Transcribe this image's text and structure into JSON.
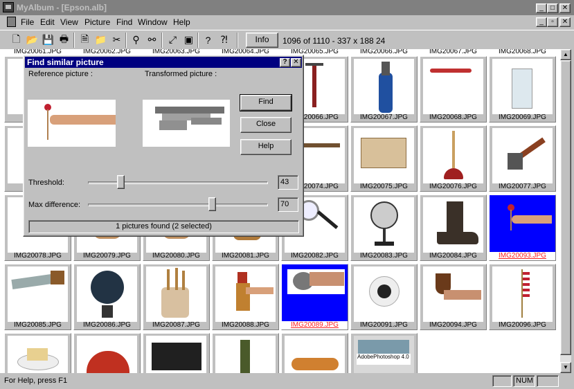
{
  "window": {
    "title": "MyAlbum - [Epson.alb]"
  },
  "menu": [
    "File",
    "Edit",
    "View",
    "Picture",
    "Find",
    "Window",
    "Help"
  ],
  "menu_underline": [
    "F",
    "E",
    "V",
    "P",
    "i",
    "W",
    "H"
  ],
  "toolbar": {
    "info_label": "Info",
    "status": "1096 of 1110 - 337 x 188  24",
    "icons": [
      "new-icon",
      "open-icon",
      "save-icon",
      "print-icon",
      "import-icon",
      "open-folder-icon",
      "cut-icon",
      "find-binoculars-icon",
      "find-similar-icon",
      "resize-icon",
      "slideshow-icon",
      "help-icon",
      "context-help-icon"
    ]
  },
  "thumbnails": [
    {
      "name": "IMG20078.JPG",
      "selected": false,
      "icon": "lollipop-hand"
    },
    {
      "name": "IMG20079.JPG",
      "selected": false,
      "icon": "item"
    },
    {
      "name": "IMG20080.JPG",
      "selected": false,
      "icon": "item"
    },
    {
      "name": "IMG20081.JPG",
      "selected": false,
      "icon": "dog"
    },
    {
      "name": "IMG20082.JPG",
      "selected": false,
      "icon": "magnifier"
    },
    {
      "name": "IMG20083.JPG",
      "selected": false,
      "icon": "fan"
    },
    {
      "name": "IMG20084.JPG",
      "selected": false,
      "icon": "boot"
    },
    {
      "name": "IMG20093.JPG",
      "selected": true,
      "icon": "lollipop-hand"
    },
    {
      "name": "IMG20085.JPG",
      "selected": false,
      "icon": "saw"
    },
    {
      "name": "IMG20086.JPG",
      "selected": false,
      "icon": "globe"
    },
    {
      "name": "IMG20087.JPG",
      "selected": false,
      "icon": "utensils"
    },
    {
      "name": "IMG20088.JPG",
      "selected": false,
      "icon": "chicken"
    },
    {
      "name": "IMG20089.JPG",
      "selected": true,
      "icon": "hand-ball"
    },
    {
      "name": "IMG20091.JPG",
      "selected": false,
      "icon": "cup"
    },
    {
      "name": "IMG20094.JPG",
      "selected": false,
      "icon": "pipe"
    },
    {
      "name": "IMG20096.JPG",
      "selected": false,
      "icon": "flag"
    }
  ],
  "row1_thumbnails": [
    {
      "name": "IMG20066.JPG",
      "icon": "pump"
    },
    {
      "name": "IMG20067.JPG",
      "icon": "golf-bag"
    },
    {
      "name": "IMG20068.JPG",
      "icon": "knife"
    },
    {
      "name": "IMG20069.JPG",
      "icon": "glass"
    }
  ],
  "row2_thumbnails": [
    {
      "name": "IMG20074.JPG",
      "icon": "key"
    },
    {
      "name": "IMG20075.JPG",
      "icon": "box"
    },
    {
      "name": "IMG20076.JPG",
      "icon": "plunger"
    },
    {
      "name": "IMG20077.JPG",
      "icon": "axe"
    }
  ],
  "row0_left_captions": [
    "IMG2006",
    "IMG2007"
  ],
  "partial_row_logo": {
    "line1": "AdobePhotoshop",
    "line2": "4.0"
  },
  "dialog": {
    "title": "Find similar picture",
    "reference_label": "Reference picture :",
    "transformed_label": "Transformed picture :",
    "find_label": "Find",
    "close_label": "Close",
    "help_label": "Help",
    "threshold_label": "Threshold:",
    "threshold_value": "43",
    "maxdiff_label": "Max difference:",
    "maxdiff_value": "70",
    "found_text": "1 pictures found (2 selected)"
  },
  "statusbar": {
    "text": "For Help, press F1",
    "num": "NUM"
  },
  "colors": {
    "selection": "#0000ff",
    "title_active": "#000080",
    "face": "#c0c0c0"
  }
}
